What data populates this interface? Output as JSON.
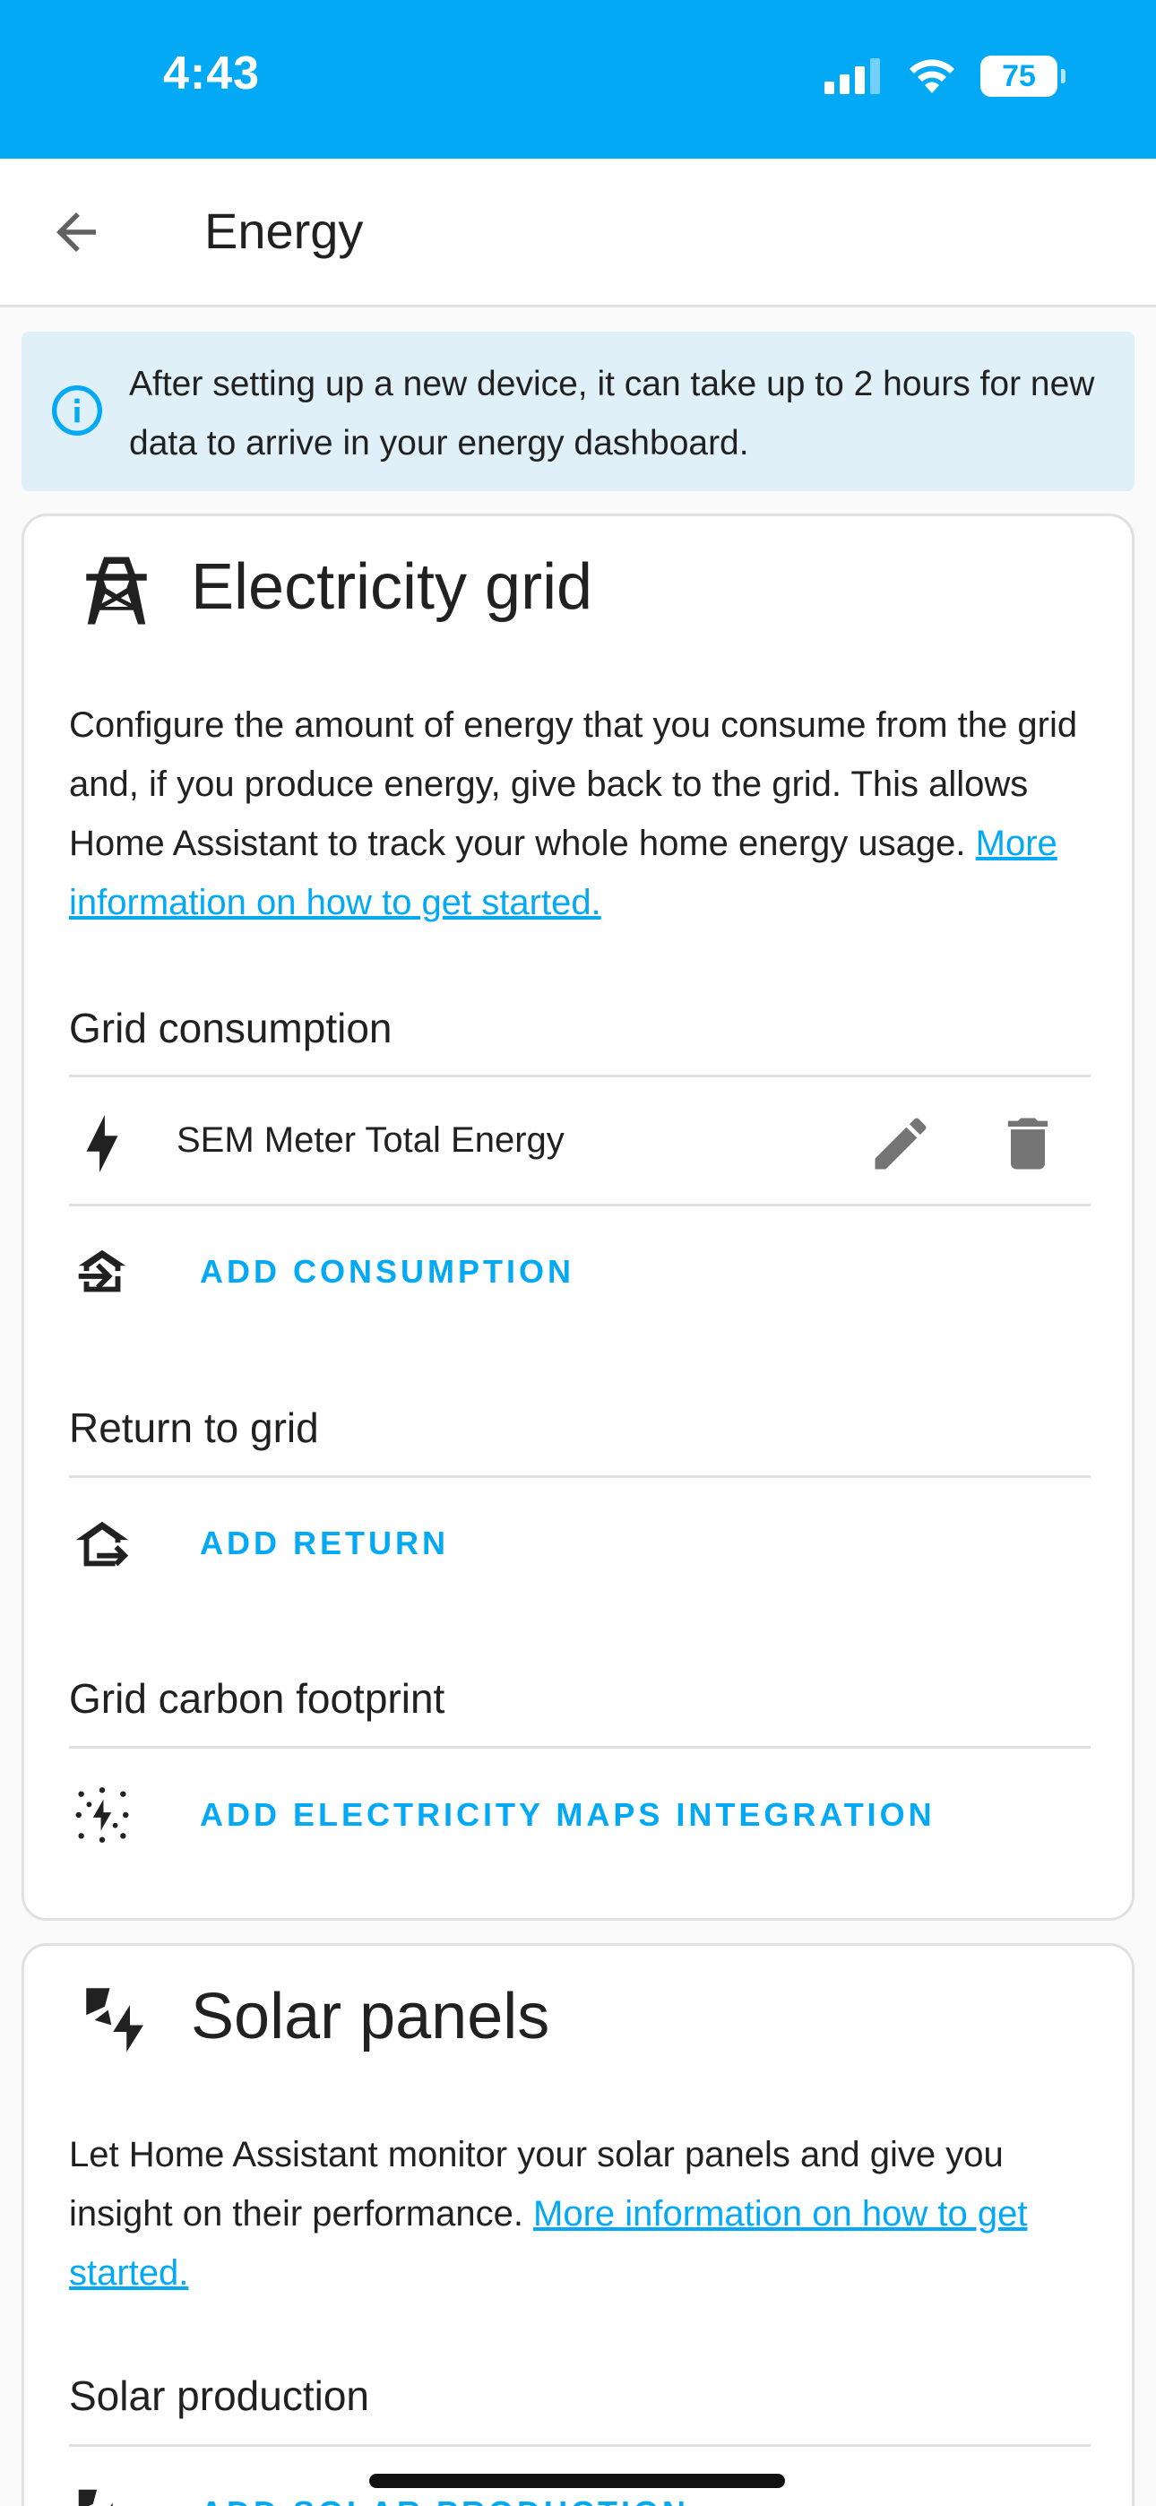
{
  "status_bar": {
    "time": "4:43",
    "battery": "75",
    "icons": [
      "cellular-signal-icon",
      "wifi-icon",
      "battery-icon"
    ]
  },
  "app_bar": {
    "title": "Energy",
    "back_icon": "arrow-left-icon"
  },
  "info_alert": {
    "icon": "info-circle-icon",
    "text": "After setting up a new device, it can take up to 2 hours for new data to arrive in your energy dashboard."
  },
  "grid_card": {
    "icon": "transmission-tower-icon",
    "title": "Electricity grid",
    "description": "Configure the amount of energy that you consume from the grid and, if you produce energy, give back to the grid. This allows Home Assistant to track your whole home energy usage. ",
    "link": "More information on how to get started.",
    "consumption": {
      "label": "Grid consumption",
      "entity": {
        "icon": "lightning-bolt-icon",
        "name": "SEM Meter Total Energy",
        "edit_icon": "pencil-icon",
        "delete_icon": "trash-can-icon"
      },
      "add_icon": "transmission-tower-import-icon",
      "add_label": "ADD CONSUMPTION"
    },
    "return": {
      "label": "Return to grid",
      "add_icon": "transmission-tower-export-icon",
      "add_label": "ADD RETURN"
    },
    "carbon": {
      "label": "Grid carbon footprint",
      "add_icon": "lightning-bolt-dotted-icon",
      "add_label": "ADD ELECTRICITY MAPS INTEGRATION"
    }
  },
  "solar_card": {
    "icon": "solar-power-icon",
    "title": "Solar panels",
    "description": "Let Home Assistant monitor your solar panels and give you insight on their performance. ",
    "link": "More information on how to get started.",
    "production": {
      "label": "Solar production",
      "add_label": "ADD SOLAR PRODUCTION"
    }
  },
  "colors": {
    "primary": "#03a9f4",
    "info_background": "#dff0f9",
    "text": "#212121",
    "icon_grey": "#757575"
  }
}
